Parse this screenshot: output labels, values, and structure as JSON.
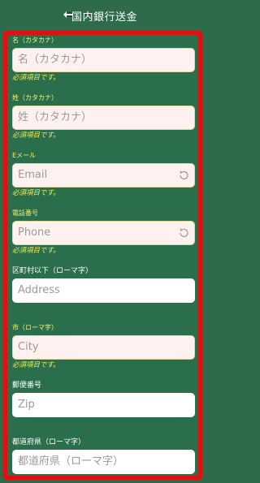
{
  "header": {
    "title": "国内銀行送金"
  },
  "fields": [
    {
      "label": "名（カタカナ）",
      "placeholder": "名（カタカナ）",
      "error": "必須項目です。"
    },
    {
      "label": "姓（カタカナ）",
      "placeholder": "姓（カタカナ）",
      "error": "必須項目です。"
    },
    {
      "label": "Eメール",
      "placeholder": "Email",
      "error": "必須項目です。"
    },
    {
      "label": "電話番号",
      "placeholder": "Phone",
      "error": "必須項目です。"
    },
    {
      "label": "区町村以下（ローマ字）",
      "placeholder": "Address"
    },
    {
      "label": "市（ローマ字）",
      "placeholder": "City",
      "error": "必須項目です。"
    },
    {
      "label": "郵便番号",
      "placeholder": "Zip"
    },
    {
      "label": "都道府県（ローマ字）",
      "placeholder": "都道府県（ローマ字）"
    }
  ],
  "icons": {
    "back": "back-arrow-icon",
    "refresh": "refresh-icon"
  },
  "colors": {
    "background": "#2e6b4a",
    "highlight_border": "#e01010",
    "label": "#f3f37a",
    "error": "#e8e85a",
    "invalid_input_bg": "#fff1ef"
  }
}
